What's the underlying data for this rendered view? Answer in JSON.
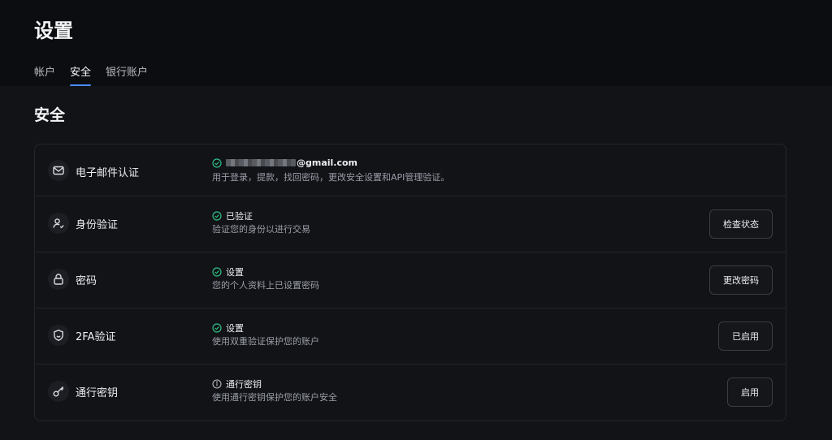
{
  "header": {
    "title": "设置",
    "tabs": [
      {
        "label": "帐户",
        "active": false
      },
      {
        "label": "安全",
        "active": true
      },
      {
        "label": "银行账户",
        "active": false
      }
    ]
  },
  "section": {
    "title": "安全"
  },
  "rows": [
    {
      "label": "电子邮件认证",
      "icon": "mail-icon",
      "status_icon": "check-circle-icon",
      "status": "@gmail.com",
      "description": "用于登录，提款，找回密码，更改安全设置和API管理验证。",
      "button": null
    },
    {
      "label": "身份验证",
      "icon": "user-check-icon",
      "status_icon": "check-circle-icon",
      "status": "已验证",
      "description": "验证您的身份以进行交易",
      "button": "检查状态"
    },
    {
      "label": "密码",
      "icon": "lock-icon",
      "status_icon": "check-circle-icon",
      "status": "设置",
      "description": "您的个人资料上已设置密码",
      "button": "更改密码"
    },
    {
      "label": "2FA验证",
      "icon": "shield-icon",
      "status_icon": "check-circle-icon",
      "status": "设置",
      "description": "使用双重验证保护您的账户",
      "button": "已启用"
    },
    {
      "label": "通行密钥",
      "icon": "key-icon",
      "status_icon": "info-circle-icon",
      "status": "通行密钥",
      "description": "使用通行密钥保护您的账户安全",
      "button": "启用"
    }
  ],
  "colors": {
    "accent": "#4a8dff",
    "success": "#2ebd85",
    "background": "#121317",
    "header_background": "#0c0d10"
  }
}
